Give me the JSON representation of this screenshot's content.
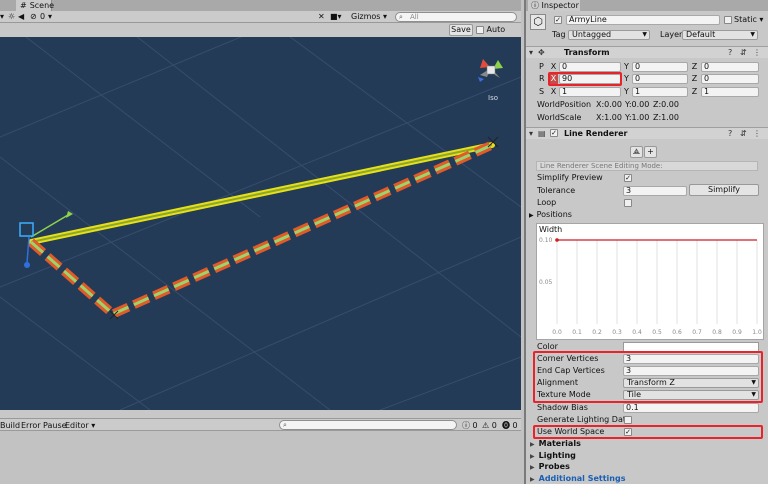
{
  "scene": {
    "tab_label": "Scene",
    "toolbar": {
      "layer_count": "0",
      "gizmos_label": "Gizmos",
      "search_placeholder": "All"
    },
    "save_label": "Save",
    "autosave_label": "Auto Save",
    "view_mode_label": "Iso"
  },
  "console": {
    "build_label": "Build",
    "error_pause_label": "Error Pause",
    "editor_label": "Editor",
    "count_1": "0",
    "count_2": "0",
    "count_3": "0"
  },
  "inspector": {
    "tab_label": "Inspector",
    "object_name": "ArmyLine",
    "static_label": "Static",
    "tag_label": "Tag",
    "tag_value": "Untagged",
    "layer_label": "Layer",
    "layer_value": "Default",
    "transform": {
      "title": "Transform",
      "p_label": "P",
      "r_label": "R",
      "s_label": "S",
      "x_label": "X",
      "y_label": "Y",
      "z_label": "Z",
      "position": {
        "x": "0",
        "y": "0",
        "z": "0"
      },
      "rotation": {
        "x": "90",
        "y": "0",
        "z": "0"
      },
      "scale": {
        "x": "1",
        "y": "1",
        "z": "1"
      },
      "world_position_label": "WorldPosition",
      "world_position": {
        "x": "X:0.00",
        "y": "Y:0.00",
        "z": "Z:0.00"
      },
      "world_scale_label": "WorldScale",
      "world_scale": {
        "x": "X:1.00",
        "y": "Y:1.00",
        "z": "Z:1.00"
      }
    },
    "line_renderer": {
      "title": "Line Renderer",
      "edit_mode_text": "Line Renderer Scene Editing Mode:",
      "simplify_preview_label": "Simplify Preview",
      "tolerance_label": "Tolerance",
      "tolerance_value": "3",
      "simplify_button": "Simplify",
      "loop_label": "Loop",
      "positions_label": "Positions",
      "width_label": "Width",
      "width_curve": {
        "y_labels": [
          "0.10",
          "0.05"
        ],
        "x_labels": [
          "0.0",
          "0.1",
          "0.2",
          "0.3",
          "0.4",
          "0.5",
          "0.6",
          "0.7",
          "0.8",
          "0.9",
          "1.0"
        ],
        "y_range": [
          0,
          0.1
        ],
        "x_range": [
          0,
          1
        ],
        "value": 0.1
      },
      "color_label": "Color",
      "corner_vertices_label": "Corner Vertices",
      "corner_vertices_value": "3",
      "end_cap_vertices_label": "End Cap Vertices",
      "end_cap_vertices_value": "3",
      "alignment_label": "Alignment",
      "alignment_value": "Transform Z",
      "texture_mode_label": "Texture Mode",
      "texture_mode_value": "Tile",
      "shadow_bias_label": "Shadow Bias",
      "shadow_bias_value": "0.1",
      "generate_lighting_label": "Generate Lighting Data",
      "use_world_space_label": "Use World Space"
    },
    "sections": {
      "materials": "Materials",
      "lighting": "Lighting",
      "probes": "Probes",
      "additional": "Additional Settings"
    }
  },
  "colors": {
    "viewport_bg": "#243b57",
    "highlight_red": "#e8242a",
    "line_orange": "#e05a2a",
    "line_green": "#9cd36b",
    "line_yellow": "#e6e01a",
    "link_blue": "#1a5fb4"
  }
}
